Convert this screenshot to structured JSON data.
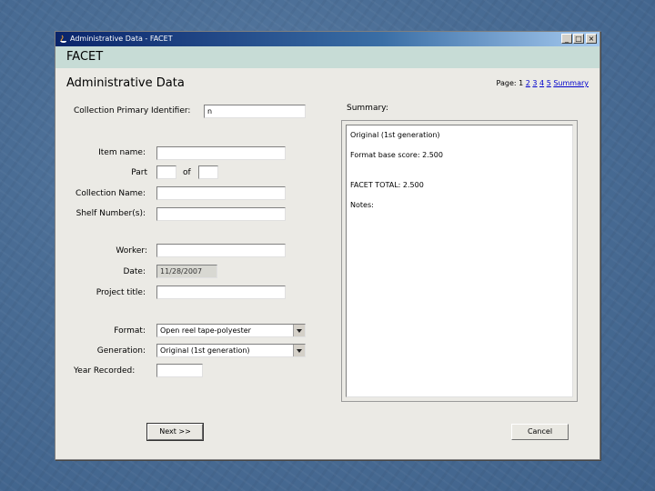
{
  "window": {
    "title": "Administrative Data - FACET",
    "minimize": "_",
    "maximize": "□",
    "close": "×"
  },
  "app_name": "FACET",
  "page_title": "Administrative Data",
  "pager": {
    "prefix": "Page:",
    "current": "1",
    "links": [
      "2",
      "3",
      "4",
      "5",
      "Summary"
    ]
  },
  "form": {
    "collection_primary_identifier": {
      "label": "Collection Primary Identifier:",
      "value": "n"
    },
    "item_name": {
      "label": "Item name:",
      "value": ""
    },
    "part": {
      "label": "Part",
      "of_label": "of",
      "value": "",
      "of_value": ""
    },
    "collection_name": {
      "label": "Collection Name:",
      "value": ""
    },
    "shelf_numbers": {
      "label": "Shelf Number(s):",
      "value": ""
    },
    "worker": {
      "label": "Worker:",
      "value": ""
    },
    "date": {
      "label": "Date:",
      "value": "11/28/2007"
    },
    "project_title": {
      "label": "Project title:",
      "value": ""
    },
    "format": {
      "label": "Format:",
      "value": "Open reel tape-polyester"
    },
    "generation": {
      "label": "Generation:",
      "value": "Original (1st generation)"
    },
    "year_recorded": {
      "label": "Year Recorded:",
      "value": ""
    }
  },
  "summary": {
    "label": "Summary:",
    "lines": [
      "Original (1st generation)",
      "Format base score: 2.500",
      "FACET TOTAL: 2.500",
      "Notes:"
    ]
  },
  "buttons": {
    "next": "Next >>",
    "cancel": "Cancel"
  },
  "colors": {
    "title_bar": "#0a246a",
    "header_band": "#c7dcd6",
    "window_bg": "#ebeae5",
    "link": "#0000cc"
  }
}
